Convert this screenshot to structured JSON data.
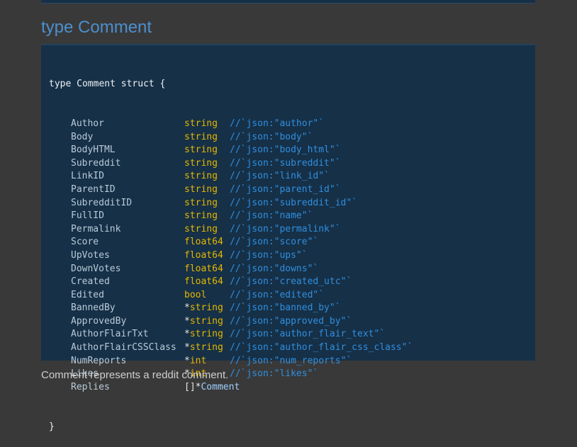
{
  "heading": "type Comment",
  "code": {
    "open_line": "type Comment struct {",
    "close_line": "}",
    "fields": [
      {
        "name": "Author",
        "ptr": "",
        "type": "string",
        "ref": "",
        "tag": "//`json:\"author\"`"
      },
      {
        "name": "Body",
        "ptr": "",
        "type": "string",
        "ref": "",
        "tag": "//`json:\"body\"`"
      },
      {
        "name": "BodyHTML",
        "ptr": "",
        "type": "string",
        "ref": "",
        "tag": "//`json:\"body_html\"`"
      },
      {
        "name": "Subreddit",
        "ptr": "",
        "type": "string",
        "ref": "",
        "tag": "//`json:\"subreddit\"`"
      },
      {
        "name": "LinkID",
        "ptr": "",
        "type": "string",
        "ref": "",
        "tag": "//`json:\"link_id\"`"
      },
      {
        "name": "ParentID",
        "ptr": "",
        "type": "string",
        "ref": "",
        "tag": "//`json:\"parent_id\"`"
      },
      {
        "name": "SubredditID",
        "ptr": "",
        "type": "string",
        "ref": "",
        "tag": "//`json:\"subreddit_id\"`"
      },
      {
        "name": "FullID",
        "ptr": "",
        "type": "string",
        "ref": "",
        "tag": "//`json:\"name\"`"
      },
      {
        "name": "Permalink",
        "ptr": "",
        "type": "string",
        "ref": "",
        "tag": "//`json:\"permalink\"`"
      },
      {
        "name": "Score",
        "ptr": "",
        "type": "float64",
        "ref": "",
        "tag": "//`json:\"score\"`"
      },
      {
        "name": "UpVotes",
        "ptr": "",
        "type": "float64",
        "ref": "",
        "tag": "//`json:\"ups\"`"
      },
      {
        "name": "DownVotes",
        "ptr": "",
        "type": "float64",
        "ref": "",
        "tag": "//`json:\"downs\"`"
      },
      {
        "name": "Created",
        "ptr": "",
        "type": "float64",
        "ref": "",
        "tag": "//`json:\"created_utc\"`"
      },
      {
        "name": "Edited",
        "ptr": "",
        "type": "bool",
        "ref": "",
        "tag": "//`json:\"edited\"`"
      },
      {
        "name": "BannedBy",
        "ptr": "*",
        "type": "string",
        "ref": "",
        "tag": "//`json:\"banned_by\"`"
      },
      {
        "name": "ApprovedBy",
        "ptr": "*",
        "type": "string",
        "ref": "",
        "tag": "//`json:\"approved_by\"`"
      },
      {
        "name": "AuthorFlairTxt",
        "ptr": "*",
        "type": "string",
        "ref": "",
        "tag": "//`json:\"author_flair_text\"`"
      },
      {
        "name": "AuthorFlairCSSClass",
        "ptr": "*",
        "type": "string",
        "ref": "",
        "tag": "//`json:\"author_flair_css_class\"`"
      },
      {
        "name": "NumReports",
        "ptr": "*",
        "type": "int",
        "ref": "",
        "tag": "//`json:\"num_reports\"`"
      },
      {
        "name": "Likes",
        "ptr": "*",
        "type": "int",
        "ref": "",
        "tag": "//`json:\"likes\"`"
      },
      {
        "name": "Replies",
        "ptr": "[]*",
        "type": "",
        "ref": "Comment",
        "tag": ""
      }
    ]
  },
  "description": "Comment represents a reddit comment."
}
